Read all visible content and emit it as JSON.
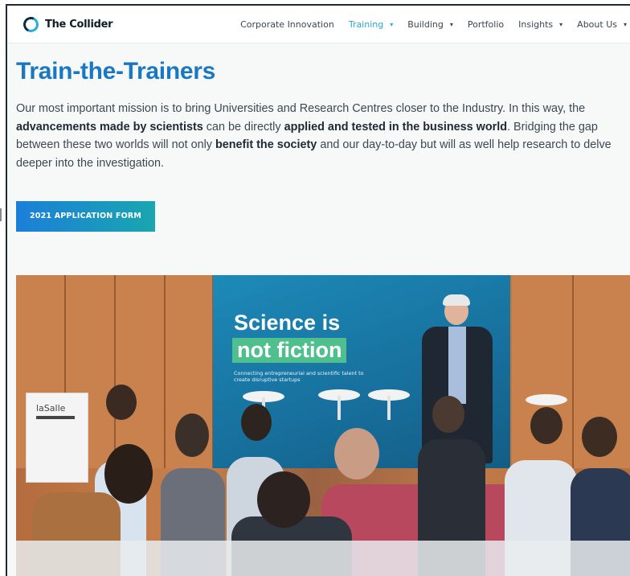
{
  "brand": {
    "name": "The Collider"
  },
  "nav": {
    "items": [
      {
        "label": "Corporate Innovation",
        "dropdown": false,
        "active": false
      },
      {
        "label": "Training",
        "dropdown": true,
        "active": true
      },
      {
        "label": "Building",
        "dropdown": true,
        "active": false
      },
      {
        "label": "Portfolio",
        "dropdown": false,
        "active": false
      },
      {
        "label": "Insights",
        "dropdown": true,
        "active": false
      },
      {
        "label": "About Us",
        "dropdown": true,
        "active": false
      }
    ],
    "caret": "▾"
  },
  "main": {
    "title": "Train-the-Trainers",
    "intro": [
      {
        "text": "Our most important mission is to bring Universities and Research Centres closer to the Industry. In this way, the ",
        "bold": false
      },
      {
        "text": "advancements made by scientists",
        "bold": true
      },
      {
        "text": " can be directly ",
        "bold": false
      },
      {
        "text": "applied and tested in the business world",
        "bold": true
      },
      {
        "text": ". Bridging the gap between these two worlds will not only ",
        "bold": false
      },
      {
        "text": "benefit the society",
        "bold": true
      },
      {
        "text": " and our day-to-day but will as well help research to delve deeper into the investigation.",
        "bold": false
      }
    ],
    "cta_label": "2021 APPLICATION FORM"
  },
  "hero": {
    "banner_line1": "Science is",
    "banner_line2": "not fiction",
    "banner_sub": "Connecting entrepreneurial and scientific talent to create disruptive startups",
    "sign_text": "laSalle"
  },
  "colors": {
    "title": "#1a78c2",
    "nav_active": "#2aa6d6",
    "cta_start": "#1b7fd8",
    "cta_end": "#1aa6b0"
  }
}
